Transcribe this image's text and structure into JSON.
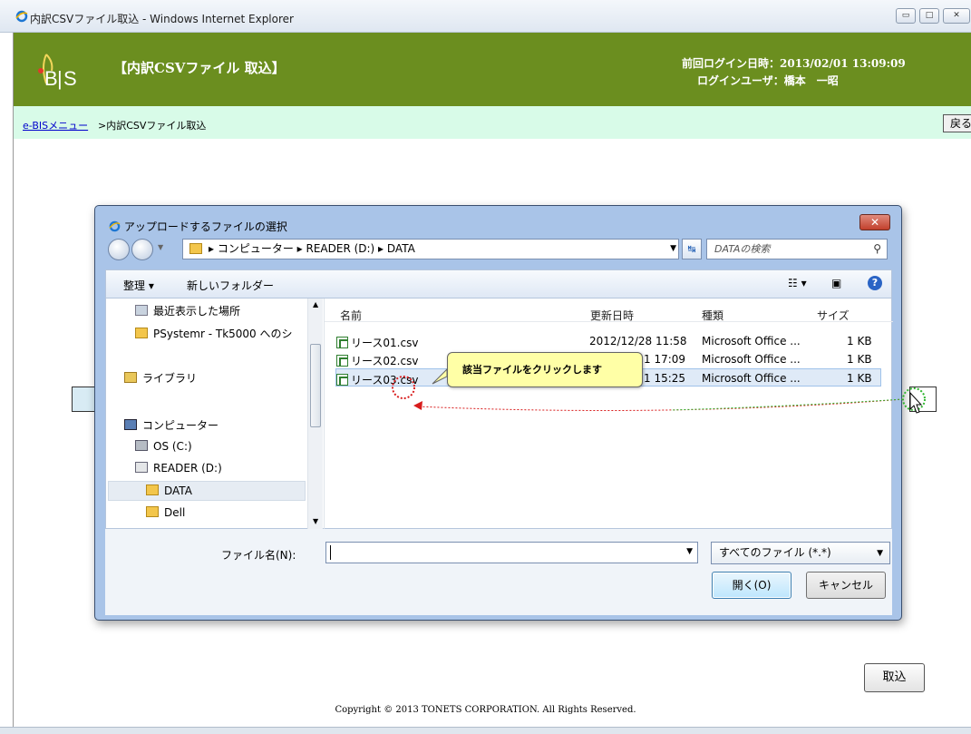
{
  "window": {
    "title": "内訳CSVファイル取込 - Windows Internet Explorer"
  },
  "header": {
    "logo": "eBIS",
    "title": "【内訳CSVファイル 取込】",
    "last_login": "前回ログイン日時：2013/02/01 13:09:09",
    "login_user": "ログインユーザ：橋本　一昭"
  },
  "breadcrumb": {
    "link": "e-BISメニュー",
    "current": ">内訳CSVファイル取込"
  },
  "page": {
    "back_label": "戻る",
    "import_label": "取込",
    "copyright": "Copyright © 2013 TONETS CORPORATION. All Rights Reserved."
  },
  "dialog": {
    "title": "アップロードするファイルの選択",
    "path": "▸ コンピューター ▸ READER (D:) ▸ DATA",
    "search_placeholder": "DATAの検索",
    "toolbar": {
      "organize": "整理 ▾",
      "new_folder": "新しいフォルダー"
    },
    "nav": [
      {
        "label": "最近表示した場所",
        "icon": "recent-places-icon"
      },
      {
        "label": "PSystemr - Tk5000 へのシ",
        "icon": "shortcut-icon"
      },
      {
        "label": "ライブラリ",
        "icon": "library-icon"
      },
      {
        "label": "コンピューター",
        "icon": "computer-icon"
      },
      {
        "label": "OS (C:)",
        "icon": "drive-icon"
      },
      {
        "label": "READER (D:)",
        "icon": "drive-icon"
      },
      {
        "label": "DATA",
        "icon": "folder-icon"
      },
      {
        "label": "Dell",
        "icon": "folder-icon"
      }
    ],
    "columns": {
      "name": "名前",
      "modified": "更新日時",
      "type": "種類",
      "size": "サイズ"
    },
    "files": [
      {
        "name": "リース01.csv",
        "modified": "2012/12/28 11:58",
        "type": "Microsoft Office ...",
        "size": "1 KB"
      },
      {
        "name": "リース02.csv",
        "modified": "1 17:09",
        "type": "Microsoft Office ...",
        "size": "1 KB"
      },
      {
        "name": "リース03.csv",
        "modified": "1 15:25",
        "type": "Microsoft Office ...",
        "size": "1 KB"
      }
    ],
    "filename_label": "ファイル名(N):",
    "filename_value": "",
    "filetype": "すべてのファイル (*.*)",
    "open_label": "開く(O)",
    "cancel_label": "キャンセル"
  },
  "callout": "該当ファイルをクリックします",
  "colors": {
    "header_green": "#6b8e1f",
    "bread_bg": "#d8fbe8",
    "callout_bg": "#ffffa6"
  }
}
